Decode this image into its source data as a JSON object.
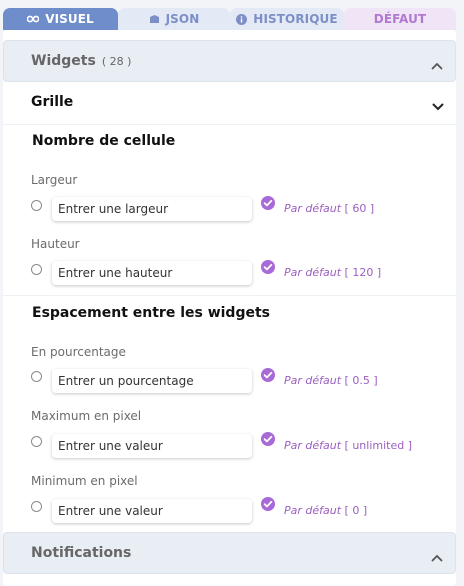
{
  "tabs": [
    {
      "label": "VISUEL",
      "icon": "eye-glasses-icon"
    },
    {
      "label": "JSON",
      "icon": "cube-icon"
    },
    {
      "label": "HISTORIQUE",
      "icon": "info-icon"
    },
    {
      "label": "DÉFAUT"
    }
  ],
  "widgets": {
    "title": "Widgets",
    "count": "( 28 )",
    "expanded": true
  },
  "grille": {
    "title": "Grille"
  },
  "cells": {
    "title": "Nombre de cellule",
    "fields": [
      {
        "label": "Largeur",
        "placeholder": "Entrer une largeur",
        "default_label": "Par défaut",
        "default_value": "[ 60 ]"
      },
      {
        "label": "Hauteur",
        "placeholder": "Entrer une hauteur",
        "default_label": "Par défaut",
        "default_value": "[ 120 ]"
      }
    ]
  },
  "spacing": {
    "title": "Espacement entre les widgets",
    "fields": [
      {
        "label": "En pourcentage",
        "placeholder": "Entrer un pourcentage",
        "default_label": "Par défaut",
        "default_value": "[ 0.5 ]"
      },
      {
        "label": "Maximum en pixel",
        "placeholder": "Entrer une valeur",
        "default_label": "Par défaut",
        "default_value": "[ unlimited ]"
      },
      {
        "label": "Minimum en pixel",
        "placeholder": "Entrer une valeur",
        "default_label": "Par défaut",
        "default_value": "[ 0 ]"
      }
    ]
  },
  "notifications": {
    "title": "Notifications"
  },
  "colors": {
    "accent": "#6f8ccb",
    "default_purple": "#9b5fc0",
    "check_purple": "#a76ad6"
  }
}
